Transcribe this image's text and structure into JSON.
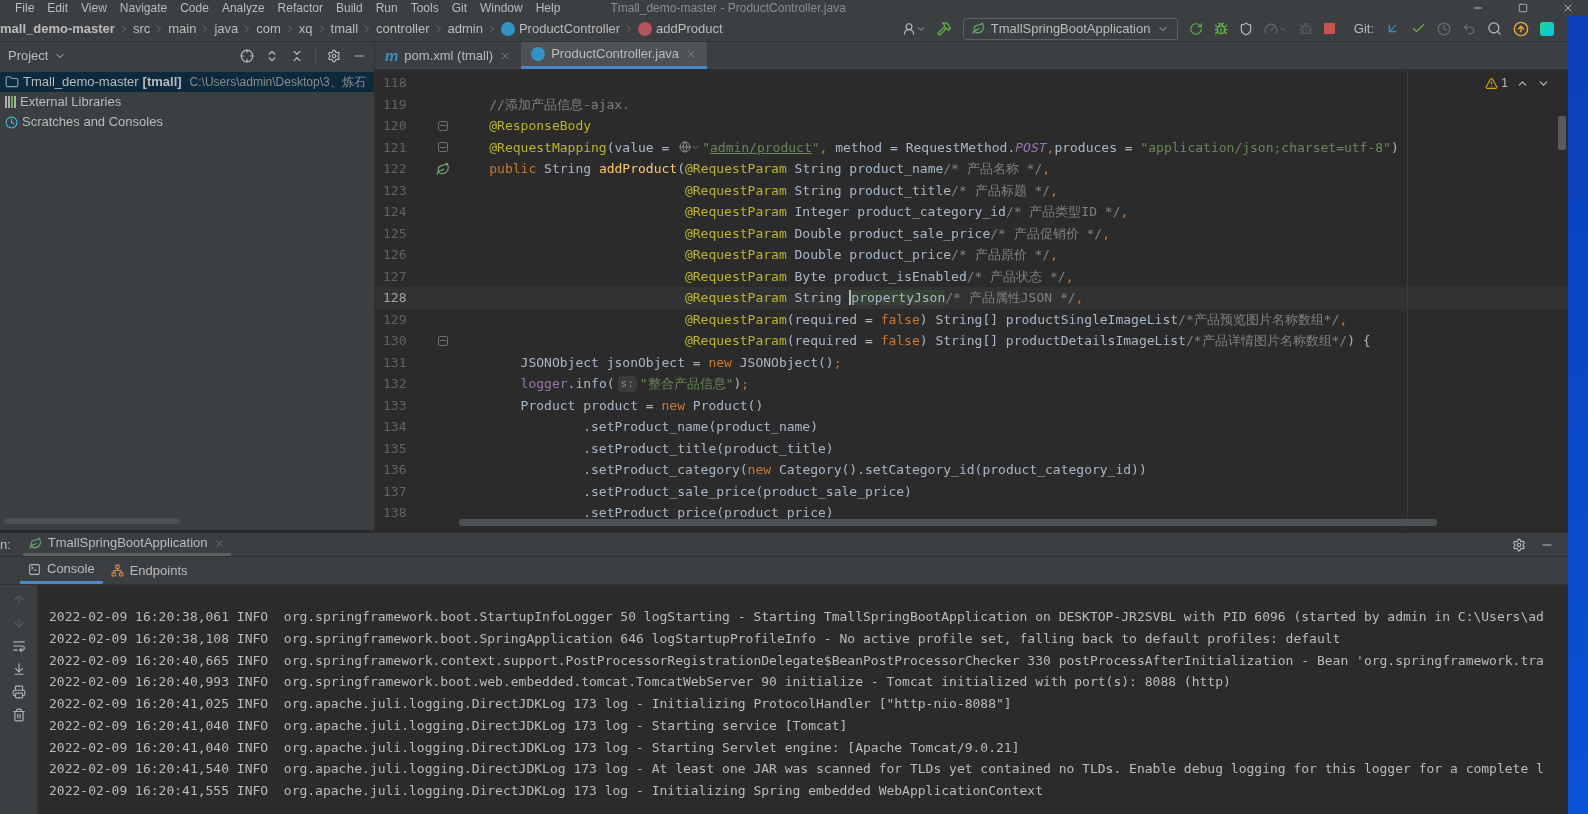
{
  "window": {
    "title": "Tmall_demo-master - ProductController.java"
  },
  "menu": [
    "File",
    "Edit",
    "View",
    "Navigate",
    "Code",
    "Analyze",
    "Refactor",
    "Build",
    "Run",
    "Tools",
    "Git",
    "Window",
    "Help"
  ],
  "breadcrumb": [
    {
      "label": "mall_demo-master",
      "kind": "project"
    },
    {
      "label": "src",
      "kind": "folder"
    },
    {
      "label": "main",
      "kind": "folder"
    },
    {
      "label": "java",
      "kind": "folder"
    },
    {
      "label": "com",
      "kind": "folder"
    },
    {
      "label": "xq",
      "kind": "folder"
    },
    {
      "label": "tmall",
      "kind": "folder"
    },
    {
      "label": "controller",
      "kind": "folder"
    },
    {
      "label": "admin",
      "kind": "folder"
    },
    {
      "label": "ProductController",
      "kind": "class"
    },
    {
      "label": "addProduct",
      "kind": "method"
    }
  ],
  "toolbar": {
    "run_config": "TmallSpringBootApplication",
    "git_label": "Git:"
  },
  "project_panel": {
    "title": "Project",
    "items": [
      {
        "label": "Tmall_demo-master",
        "module": "[tmall]",
        "path": "C:\\Users\\admin\\Desktop\\3、炼石",
        "kind": "module",
        "selected": true
      },
      {
        "label": "External Libraries",
        "kind": "libraries",
        "selected": false
      },
      {
        "label": "Scratches and Consoles",
        "kind": "scratches",
        "selected": false
      }
    ]
  },
  "editor": {
    "tabs": [
      {
        "label": "pom.xml (tmall)",
        "kind": "maven",
        "badge": "m",
        "selected": false
      },
      {
        "label": "ProductController.java",
        "kind": "class",
        "selected": true
      }
    ],
    "warnings": "1",
    "lines": [
      {
        "number": "118",
        "current": false,
        "fold": false,
        "bean": false
      },
      {
        "number": "119",
        "current": false,
        "fold": false,
        "bean": false,
        "kind": "member",
        "tokens": [
          {
            "kind": "cmt",
            "text": "//添加产品信息-ajax."
          }
        ]
      },
      {
        "number": "120",
        "current": false,
        "fold": true,
        "bean": false,
        "kind": "member",
        "tokens": [
          {
            "kind": "ann",
            "text": "@ResponseBody"
          }
        ]
      },
      {
        "number": "121",
        "current": false,
        "fold": true,
        "bean": false,
        "kind": "member",
        "tokens": [
          {
            "kind": "ann",
            "text": "@RequestMapping"
          },
          {
            "kind": "plain",
            "text": "(value = "
          },
          {
            "kind": "globe"
          },
          {
            "kind": "str",
            "text": "\""
          },
          {
            "kind": "link",
            "text": "admin/product"
          },
          {
            "kind": "str",
            "text": "\""
          },
          {
            "kind": "kw",
            "text": ","
          },
          {
            "kind": "plain",
            "text": " method = RequestMethod."
          },
          {
            "kind": "const",
            "text": "POST"
          },
          {
            "kind": "kw",
            "text": ","
          },
          {
            "kind": "plain",
            "text": "produces = "
          },
          {
            "kind": "str",
            "text": "\"application/json;charset=utf-8\""
          },
          {
            "kind": "plain",
            "text": ")"
          }
        ]
      },
      {
        "number": "122",
        "current": false,
        "fold": false,
        "bean": true,
        "kind": "member",
        "tokens": [
          {
            "kind": "kw",
            "text": "public"
          },
          {
            "kind": "plain",
            "text": " String "
          },
          {
            "kind": "fn",
            "text": "addProduct"
          },
          {
            "kind": "plain",
            "text": "("
          },
          {
            "kind": "ann",
            "text": "@RequestParam"
          },
          {
            "kind": "plain",
            "text": " String product_name"
          },
          {
            "kind": "cmt",
            "text": "/* 产品名称 */"
          },
          {
            "kind": "kw",
            "text": ","
          }
        ]
      },
      {
        "number": "123",
        "current": false,
        "fold": false,
        "bean": false,
        "kind": "param",
        "tokens": [
          {
            "kind": "ann",
            "text": "@RequestParam"
          },
          {
            "kind": "plain",
            "text": " String product_title"
          },
          {
            "kind": "cmt",
            "text": "/* 产品标题 */"
          },
          {
            "kind": "kw",
            "text": ","
          }
        ]
      },
      {
        "number": "124",
        "current": false,
        "fold": false,
        "bean": false,
        "kind": "param",
        "tokens": [
          {
            "kind": "ann",
            "text": "@RequestParam"
          },
          {
            "kind": "plain",
            "text": " Integer product_category_id"
          },
          {
            "kind": "cmt",
            "text": "/* 产品类型ID */"
          },
          {
            "kind": "kw",
            "text": ","
          }
        ]
      },
      {
        "number": "125",
        "current": false,
        "fold": false,
        "bean": false,
        "kind": "param",
        "tokens": [
          {
            "kind": "ann",
            "text": "@RequestParam"
          },
          {
            "kind": "plain",
            "text": " Double product_sale_price"
          },
          {
            "kind": "cmt",
            "text": "/* 产品促销价 */"
          },
          {
            "kind": "kw",
            "text": ","
          }
        ]
      },
      {
        "number": "126",
        "current": false,
        "fold": false,
        "bean": false,
        "kind": "param",
        "tokens": [
          {
            "kind": "ann",
            "text": "@RequestParam"
          },
          {
            "kind": "plain",
            "text": " Double product_price"
          },
          {
            "kind": "cmt",
            "text": "/* 产品原价 */"
          },
          {
            "kind": "kw",
            "text": ","
          }
        ]
      },
      {
        "number": "127",
        "current": false,
        "fold": false,
        "bean": false,
        "kind": "param",
        "tokens": [
          {
            "kind": "ann",
            "text": "@RequestParam"
          },
          {
            "kind": "plain",
            "text": " Byte product_isEnabled"
          },
          {
            "kind": "cmt",
            "text": "/* 产品状态 */"
          },
          {
            "kind": "kw",
            "text": ","
          }
        ]
      },
      {
        "number": "128",
        "current": true,
        "fold": false,
        "bean": false,
        "kind": "param",
        "tokens": [
          {
            "kind": "ann",
            "text": "@RequestParam"
          },
          {
            "kind": "plain",
            "text": " String "
          },
          {
            "kind": "usage",
            "text": "propertyJson"
          },
          {
            "kind": "cmt",
            "text": "/* 产品属性JSON */"
          },
          {
            "kind": "kw",
            "text": ","
          }
        ]
      },
      {
        "number": "129",
        "current": false,
        "fold": false,
        "bean": false,
        "kind": "param",
        "tokens": [
          {
            "kind": "ann",
            "text": "@RequestParam"
          },
          {
            "kind": "plain",
            "text": "(required = "
          },
          {
            "kind": "kw",
            "text": "false"
          },
          {
            "kind": "plain",
            "text": ") String[] productSingleImageList"
          },
          {
            "kind": "cmt",
            "text": "/*产品预览图片名称数组*/"
          },
          {
            "kind": "kw",
            "text": ","
          }
        ]
      },
      {
        "number": "130",
        "current": false,
        "fold": true,
        "bean": false,
        "kind": "param",
        "tokens": [
          {
            "kind": "ann",
            "text": "@RequestParam"
          },
          {
            "kind": "plain",
            "text": "(required = "
          },
          {
            "kind": "kw",
            "text": "false"
          },
          {
            "kind": "plain",
            "text": ") String[] productDetailsImageList"
          },
          {
            "kind": "cmt",
            "text": "/*产品详情图片名称数组*/"
          },
          {
            "kind": "plain",
            "text": ") {"
          }
        ]
      },
      {
        "number": "131",
        "current": false,
        "fold": false,
        "bean": false,
        "kind": "body",
        "tokens": [
          {
            "kind": "plain",
            "text": "JSONObject jsonObject = "
          },
          {
            "kind": "kw",
            "text": "new"
          },
          {
            "kind": "plain",
            "text": " JSONObject()"
          },
          {
            "kind": "kw",
            "text": ";"
          }
        ]
      },
      {
        "number": "132",
        "current": false,
        "fold": false,
        "bean": false,
        "kind": "body",
        "tokens": [
          {
            "kind": "field",
            "text": "logger"
          },
          {
            "kind": "plain",
            "text": ".info("
          },
          {
            "kind": "hint",
            "text": "s:"
          },
          {
            "kind": "str",
            "text": "\"整合产品信息\""
          },
          {
            "kind": "plain",
            "text": ")"
          },
          {
            "kind": "kw",
            "text": ";"
          }
        ]
      },
      {
        "number": "133",
        "current": false,
        "fold": false,
        "bean": false,
        "kind": "body",
        "tokens": [
          {
            "kind": "plain",
            "text": "Product product = "
          },
          {
            "kind": "kw",
            "text": "new"
          },
          {
            "kind": "plain",
            "text": " Product()"
          }
        ]
      },
      {
        "number": "134",
        "current": false,
        "fold": false,
        "bean": false,
        "kind": "chain",
        "tokens": [
          {
            "kind": "plain",
            "text": ".setProduct_name(product_name)"
          }
        ]
      },
      {
        "number": "135",
        "current": false,
        "fold": false,
        "bean": false,
        "kind": "chain",
        "tokens": [
          {
            "kind": "plain",
            "text": ".setProduct_title(product_title)"
          }
        ]
      },
      {
        "number": "136",
        "current": false,
        "fold": false,
        "bean": false,
        "kind": "chain",
        "tokens": [
          {
            "kind": "plain",
            "text": ".setProduct_category("
          },
          {
            "kind": "kw",
            "text": "new"
          },
          {
            "kind": "plain",
            "text": " Category().setCategory_id(product_category_id))"
          }
        ]
      },
      {
        "number": "137",
        "current": false,
        "fold": false,
        "bean": false,
        "kind": "chain",
        "tokens": [
          {
            "kind": "plain",
            "text": ".setProduct_sale_price(product_sale_price)"
          }
        ]
      },
      {
        "number": "138",
        "current": false,
        "fold": false,
        "bean": false,
        "kind": "chain",
        "tokens": [
          {
            "kind": "plain",
            "text": ".setProduct_price(product_price)"
          }
        ]
      }
    ]
  },
  "run_panel": {
    "label": "n:",
    "tab": "TmallSpringBootApplication",
    "tabs": [
      {
        "label": "Console",
        "kind": "console",
        "selected": true
      },
      {
        "label": "Endpoints",
        "kind": "endpoints",
        "selected": false
      }
    ],
    "log": [
      "2022-02-09 16:20:38,061 INFO  org.springframework.boot.StartupInfoLogger 50 logStarting - Starting TmallSpringBootApplication on DESKTOP-JR2SVBL with PID 6096 (started by admin in C:\\Users\\ad",
      "2022-02-09 16:20:38,108 INFO  org.springframework.boot.SpringApplication 646 logStartupProfileInfo - No active profile set, falling back to default profiles: default",
      "2022-02-09 16:20:40,665 INFO  org.springframework.context.support.PostProcessorRegistrationDelegate$BeanPostProcessorChecker 330 postProcessAfterInitialization - Bean 'org.springframework.tra",
      "2022-02-09 16:20:40,993 INFO  org.springframework.boot.web.embedded.tomcat.TomcatWebServer 90 initialize - Tomcat initialized with port(s): 8088 (http)",
      "2022-02-09 16:20:41,025 INFO  org.apache.juli.logging.DirectJDKLog 173 log - Initializing ProtocolHandler [\"http-nio-8088\"]",
      "2022-02-09 16:20:41,040 INFO  org.apache.juli.logging.DirectJDKLog 173 log - Starting service [Tomcat]",
      "2022-02-09 16:20:41,040 INFO  org.apache.juli.logging.DirectJDKLog 173 log - Starting Servlet engine: [Apache Tomcat/9.0.21]",
      "2022-02-09 16:20:41,540 INFO  org.apache.juli.logging.DirectJDKLog 173 log - At least one JAR was scanned for TLDs yet contained no TLDs. Enable debug logging for this logger for a complete l",
      "2022-02-09 16:20:41,555 INFO  org.apache.juli.logging.DirectJDKLog 173 log - Initializing Spring embedded WebApplicationContext"
    ]
  }
}
